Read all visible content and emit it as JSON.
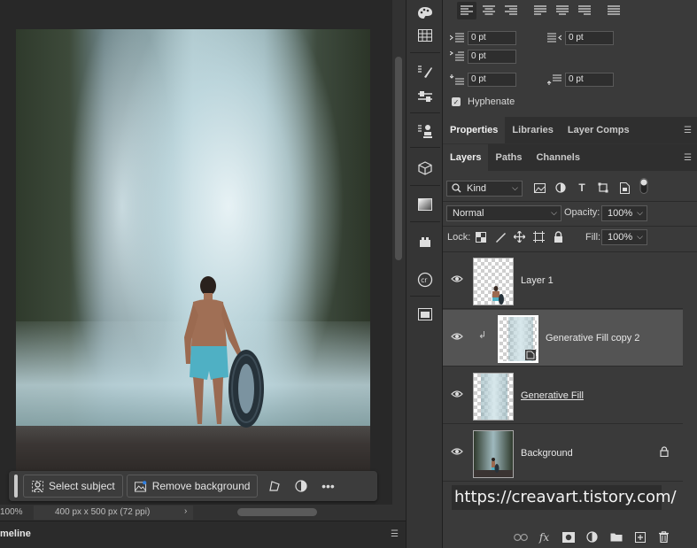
{
  "canvas": {
    "zoom": "100%",
    "doc_info": "400 px x 500 px (72 ppi)",
    "doc_arrow": "›"
  },
  "taskbar": {
    "select_subject": "Select subject",
    "remove_background": "Remove background",
    "more": "•••"
  },
  "timeline": {
    "label": "meline"
  },
  "paragraph": {
    "indent_left": "0 pt",
    "indent_right": "0 pt",
    "indent_first": "0 pt",
    "space_before": "0 pt",
    "space_after": "0 pt",
    "hyphenate": "Hyphenate"
  },
  "tabs_top": [
    "Properties",
    "Libraries",
    "Layer Comps"
  ],
  "tabs_layers": [
    "Layers",
    "Paths",
    "Channels"
  ],
  "layers_panel": {
    "filter_kind": "Kind",
    "blend_mode": "Normal",
    "opacity_label": "Opacity:",
    "opacity_value": "100%",
    "lock_label": "Lock:",
    "fill_label": "Fill:",
    "fill_value": "100%",
    "layers": [
      {
        "name": "Layer 1"
      },
      {
        "name": "Generative Fill copy 2"
      },
      {
        "name": "Generative Fill"
      },
      {
        "name": "Background"
      }
    ]
  },
  "watermark": "https://creavart.tistory.com/",
  "icon_names": [
    "eye-icon",
    "lock-icon",
    "chain-link-icon",
    "fx-icon",
    "mask-icon",
    "adjustment-icon",
    "folder-icon",
    "new-layer-icon",
    "trash-icon"
  ]
}
